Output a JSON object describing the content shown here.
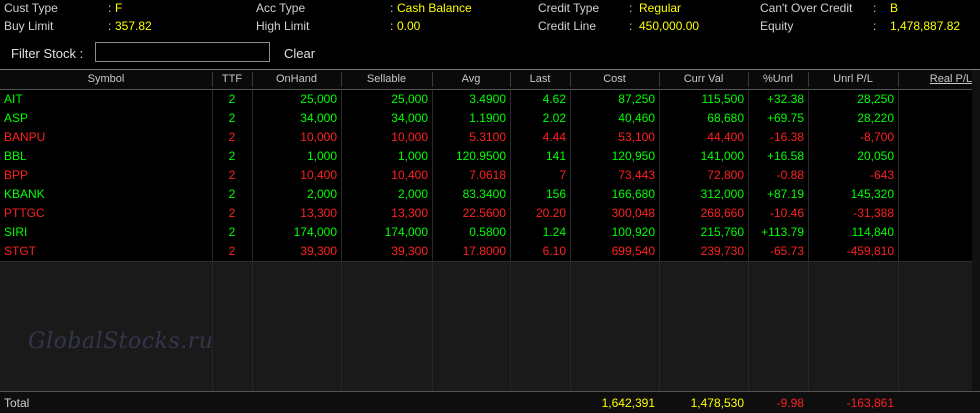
{
  "account": {
    "cust_type_label": "Cust Type",
    "cust_type_value": "F",
    "buy_limit_label": "Buy Limit",
    "buy_limit_value": "357.82",
    "acc_type_label": "Acc Type",
    "acc_type_value": "Cash Balance",
    "high_limit_label": "High Limit",
    "high_limit_value": "0.00",
    "credit_type_label": "Credit Type",
    "credit_type_value": "Regular",
    "credit_line_label": "Credit Line",
    "credit_line_value": "450,000.00",
    "cant_over_label": "Can't Over Credit",
    "cant_over_value": "B",
    "equity_label": "Equity",
    "equity_value": "1,478,887.82",
    "colon": ":"
  },
  "filter": {
    "label": "Filter Stock :",
    "value": "",
    "clear_label": "Clear"
  },
  "columns": [
    "Symbol",
    "TTF",
    "OnHand",
    "Sellable",
    "Avg",
    "Last",
    "Cost",
    "Curr Val",
    "%Unrl",
    "Unrl P/L",
    "Real P/L"
  ],
  "rows": [
    {
      "symbol": "AIT",
      "ttf": "2",
      "onhand": "25,000",
      "sellable": "25,000",
      "avg": "3.4900",
      "last": "4.62",
      "cost": "87,250",
      "currval": "115,500",
      "pct": "+32.38",
      "unrl": "28,250",
      "real": "",
      "trend": "up"
    },
    {
      "symbol": "ASP",
      "ttf": "2",
      "onhand": "34,000",
      "sellable": "34,000",
      "avg": "1.1900",
      "last": "2.02",
      "cost": "40,460",
      "currval": "68,680",
      "pct": "+69.75",
      "unrl": "28,220",
      "real": "",
      "trend": "up"
    },
    {
      "symbol": "BANPU",
      "ttf": "2",
      "onhand": "10,000",
      "sellable": "10,000",
      "avg": "5.3100",
      "last": "4.44",
      "cost": "53,100",
      "currval": "44,400",
      "pct": "-16.38",
      "unrl": "-8,700",
      "real": "",
      "trend": "down"
    },
    {
      "symbol": "BBL",
      "ttf": "2",
      "onhand": "1,000",
      "sellable": "1,000",
      "avg": "120.9500",
      "last": "141",
      "cost": "120,950",
      "currval": "141,000",
      "pct": "+16.58",
      "unrl": "20,050",
      "real": "",
      "trend": "up"
    },
    {
      "symbol": "BPP",
      "ttf": "2",
      "onhand": "10,400",
      "sellable": "10,400",
      "avg": "7.0618",
      "last": "7",
      "cost": "73,443",
      "currval": "72,800",
      "pct": "-0.88",
      "unrl": "-643",
      "real": "",
      "trend": "down"
    },
    {
      "symbol": "KBANK",
      "ttf": "2",
      "onhand": "2,000",
      "sellable": "2,000",
      "avg": "83.3400",
      "last": "156",
      "cost": "166,680",
      "currval": "312,000",
      "pct": "+87.19",
      "unrl": "145,320",
      "real": "",
      "trend": "up"
    },
    {
      "symbol": "PTTGC",
      "ttf": "2",
      "onhand": "13,300",
      "sellable": "13,300",
      "avg": "22.5600",
      "last": "20.20",
      "cost": "300,048",
      "currval": "268,660",
      "pct": "-10.46",
      "unrl": "-31,388",
      "real": "",
      "trend": "down"
    },
    {
      "symbol": "SIRI",
      "ttf": "2",
      "onhand": "174,000",
      "sellable": "174,000",
      "avg": "0.5800",
      "last": "1.24",
      "cost": "100,920",
      "currval": "215,760",
      "pct": "+113.79",
      "unrl": "114,840",
      "real": "",
      "trend": "up"
    },
    {
      "symbol": "STGT",
      "ttf": "2",
      "onhand": "39,300",
      "sellable": "39,300",
      "avg": "17.8000",
      "last": "6.10",
      "cost": "699,540",
      "currval": "239,730",
      "pct": "-65.73",
      "unrl": "-459,810",
      "real": "",
      "trend": "down"
    }
  ],
  "total": {
    "label": "Total",
    "cost": "1,642,391",
    "currval": "1,478,530",
    "pct": "-9.98",
    "unrl": "-163,861"
  },
  "watermark": "GlobalStocks.ru",
  "colors": {
    "up": "#00ff00",
    "down": "#ff2020",
    "value": "#ffff00",
    "ttf_up": "#00ff00",
    "ttf_down": "#ff2020"
  }
}
